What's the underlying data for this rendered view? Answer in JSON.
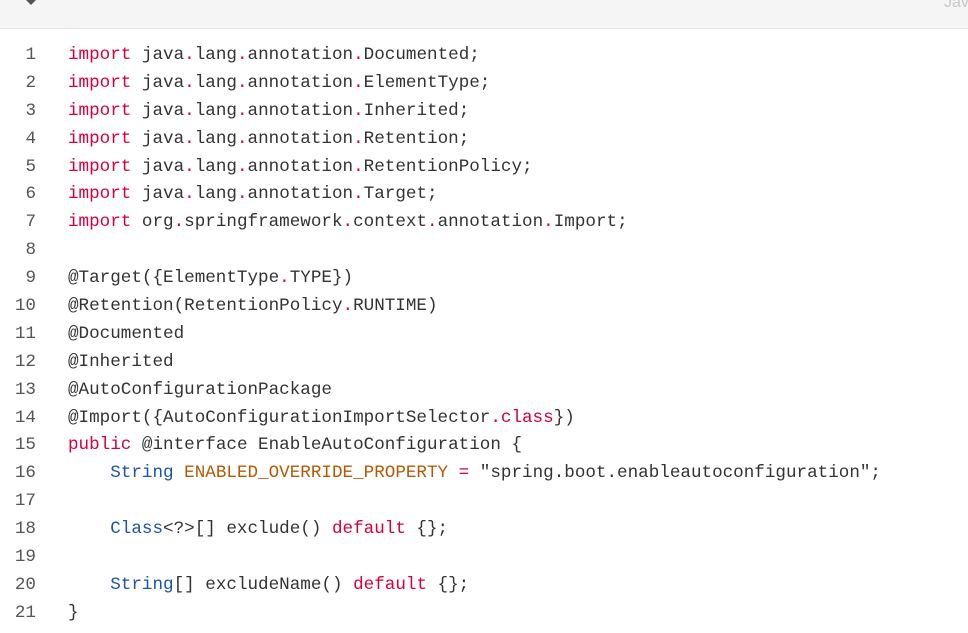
{
  "header": {
    "collapse_icon": "caret-down-icon",
    "language_label": "Java"
  },
  "colors": {
    "keyword": "#d7003a",
    "type": "#1a55a8",
    "constant": "#b35a07",
    "text": "#333333"
  },
  "code": {
    "lines": [
      [
        [
          "kw",
          "import"
        ],
        [
          "tx",
          " java"
        ],
        [
          "p",
          "."
        ],
        [
          "tx",
          "lang"
        ],
        [
          "p",
          "."
        ],
        [
          "tx",
          "annotation"
        ],
        [
          "p",
          "."
        ],
        [
          "tx",
          "Documented;"
        ]
      ],
      [
        [
          "kw",
          "import"
        ],
        [
          "tx",
          " java"
        ],
        [
          "p",
          "."
        ],
        [
          "tx",
          "lang"
        ],
        [
          "p",
          "."
        ],
        [
          "tx",
          "annotation"
        ],
        [
          "p",
          "."
        ],
        [
          "tx",
          "ElementType;"
        ]
      ],
      [
        [
          "kw",
          "import"
        ],
        [
          "tx",
          " java"
        ],
        [
          "p",
          "."
        ],
        [
          "tx",
          "lang"
        ],
        [
          "p",
          "."
        ],
        [
          "tx",
          "annotation"
        ],
        [
          "p",
          "."
        ],
        [
          "tx",
          "Inherited;"
        ]
      ],
      [
        [
          "kw",
          "import"
        ],
        [
          "tx",
          " java"
        ],
        [
          "p",
          "."
        ],
        [
          "tx",
          "lang"
        ],
        [
          "p",
          "."
        ],
        [
          "tx",
          "annotation"
        ],
        [
          "p",
          "."
        ],
        [
          "tx",
          "Retention;"
        ]
      ],
      [
        [
          "kw",
          "import"
        ],
        [
          "tx",
          " java"
        ],
        [
          "p",
          "."
        ],
        [
          "tx",
          "lang"
        ],
        [
          "p",
          "."
        ],
        [
          "tx",
          "annotation"
        ],
        [
          "p",
          "."
        ],
        [
          "tx",
          "RetentionPolicy;"
        ]
      ],
      [
        [
          "kw",
          "import"
        ],
        [
          "tx",
          " java"
        ],
        [
          "p",
          "."
        ],
        [
          "tx",
          "lang"
        ],
        [
          "p",
          "."
        ],
        [
          "tx",
          "annotation"
        ],
        [
          "p",
          "."
        ],
        [
          "tx",
          "Target;"
        ]
      ],
      [
        [
          "kw",
          "import"
        ],
        [
          "tx",
          " org"
        ],
        [
          "p",
          "."
        ],
        [
          "tx",
          "springframework"
        ],
        [
          "p",
          "."
        ],
        [
          "tx",
          "context"
        ],
        [
          "p",
          "."
        ],
        [
          "tx",
          "annotation"
        ],
        [
          "p",
          "."
        ],
        [
          "tx",
          "Import;"
        ]
      ],
      [],
      [
        [
          "tx",
          "@Target({ElementType"
        ],
        [
          "p",
          "."
        ],
        [
          "tx",
          "TYPE})"
        ]
      ],
      [
        [
          "tx",
          "@Retention(RetentionPolicy"
        ],
        [
          "p",
          "."
        ],
        [
          "tx",
          "RUNTIME)"
        ]
      ],
      [
        [
          "tx",
          "@Documented"
        ]
      ],
      [
        [
          "tx",
          "@Inherited"
        ]
      ],
      [
        [
          "tx",
          "@AutoConfigurationPackage"
        ]
      ],
      [
        [
          "tx",
          "@Import({AutoConfigurationImportSelector"
        ],
        [
          "kw",
          ".class"
        ],
        [
          "tx",
          "})"
        ]
      ],
      [
        [
          "kw",
          "public"
        ],
        [
          "tx",
          " @interface EnableAutoConfiguration {"
        ]
      ],
      [
        [
          "tx",
          "    "
        ],
        [
          "ty",
          "String"
        ],
        [
          "tx",
          " "
        ],
        [
          "cn",
          "ENABLED_OVERRIDE_PROPERTY"
        ],
        [
          "tx",
          " "
        ],
        [
          "p",
          "="
        ],
        [
          "tx",
          " \"spring.boot.enableautoconfiguration\";"
        ]
      ],
      [],
      [
        [
          "tx",
          "    "
        ],
        [
          "ty",
          "Class"
        ],
        [
          "tx",
          "<?>[] exclude() "
        ],
        [
          "kw",
          "default"
        ],
        [
          "tx",
          " {};"
        ]
      ],
      [],
      [
        [
          "tx",
          "    "
        ],
        [
          "ty",
          "String"
        ],
        [
          "tx",
          "[] excludeName() "
        ],
        [
          "kw",
          "default"
        ],
        [
          "tx",
          " {};"
        ]
      ],
      [
        [
          "tx",
          "}"
        ]
      ]
    ]
  }
}
